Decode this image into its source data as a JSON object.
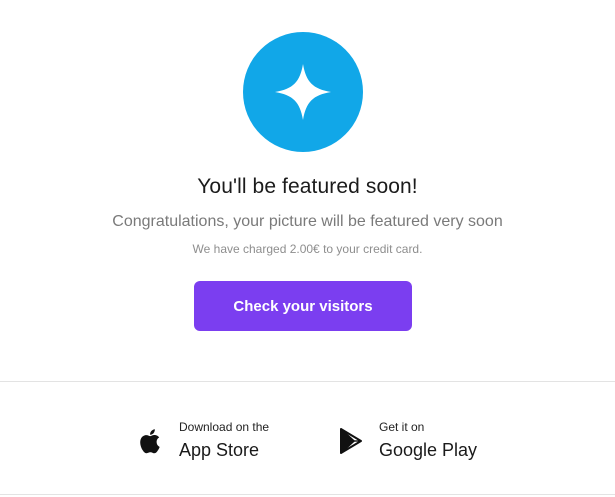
{
  "badge": {
    "icon": "sparkle-star-icon",
    "color": "#11a7e8"
  },
  "title": "You'll be featured soon!",
  "subtitle": "Congratulations, your picture will be featured very soon",
  "note": "We have charged 2.00€ to your credit card.",
  "cta": {
    "label": "Check your visitors",
    "color": "#7b3ef0"
  },
  "stores": {
    "apple": {
      "icon": "apple-icon",
      "small": "Download on the",
      "big": "App Store"
    },
    "google": {
      "icon": "google-play-icon",
      "small": "Get it on",
      "big": "Google Play"
    }
  }
}
